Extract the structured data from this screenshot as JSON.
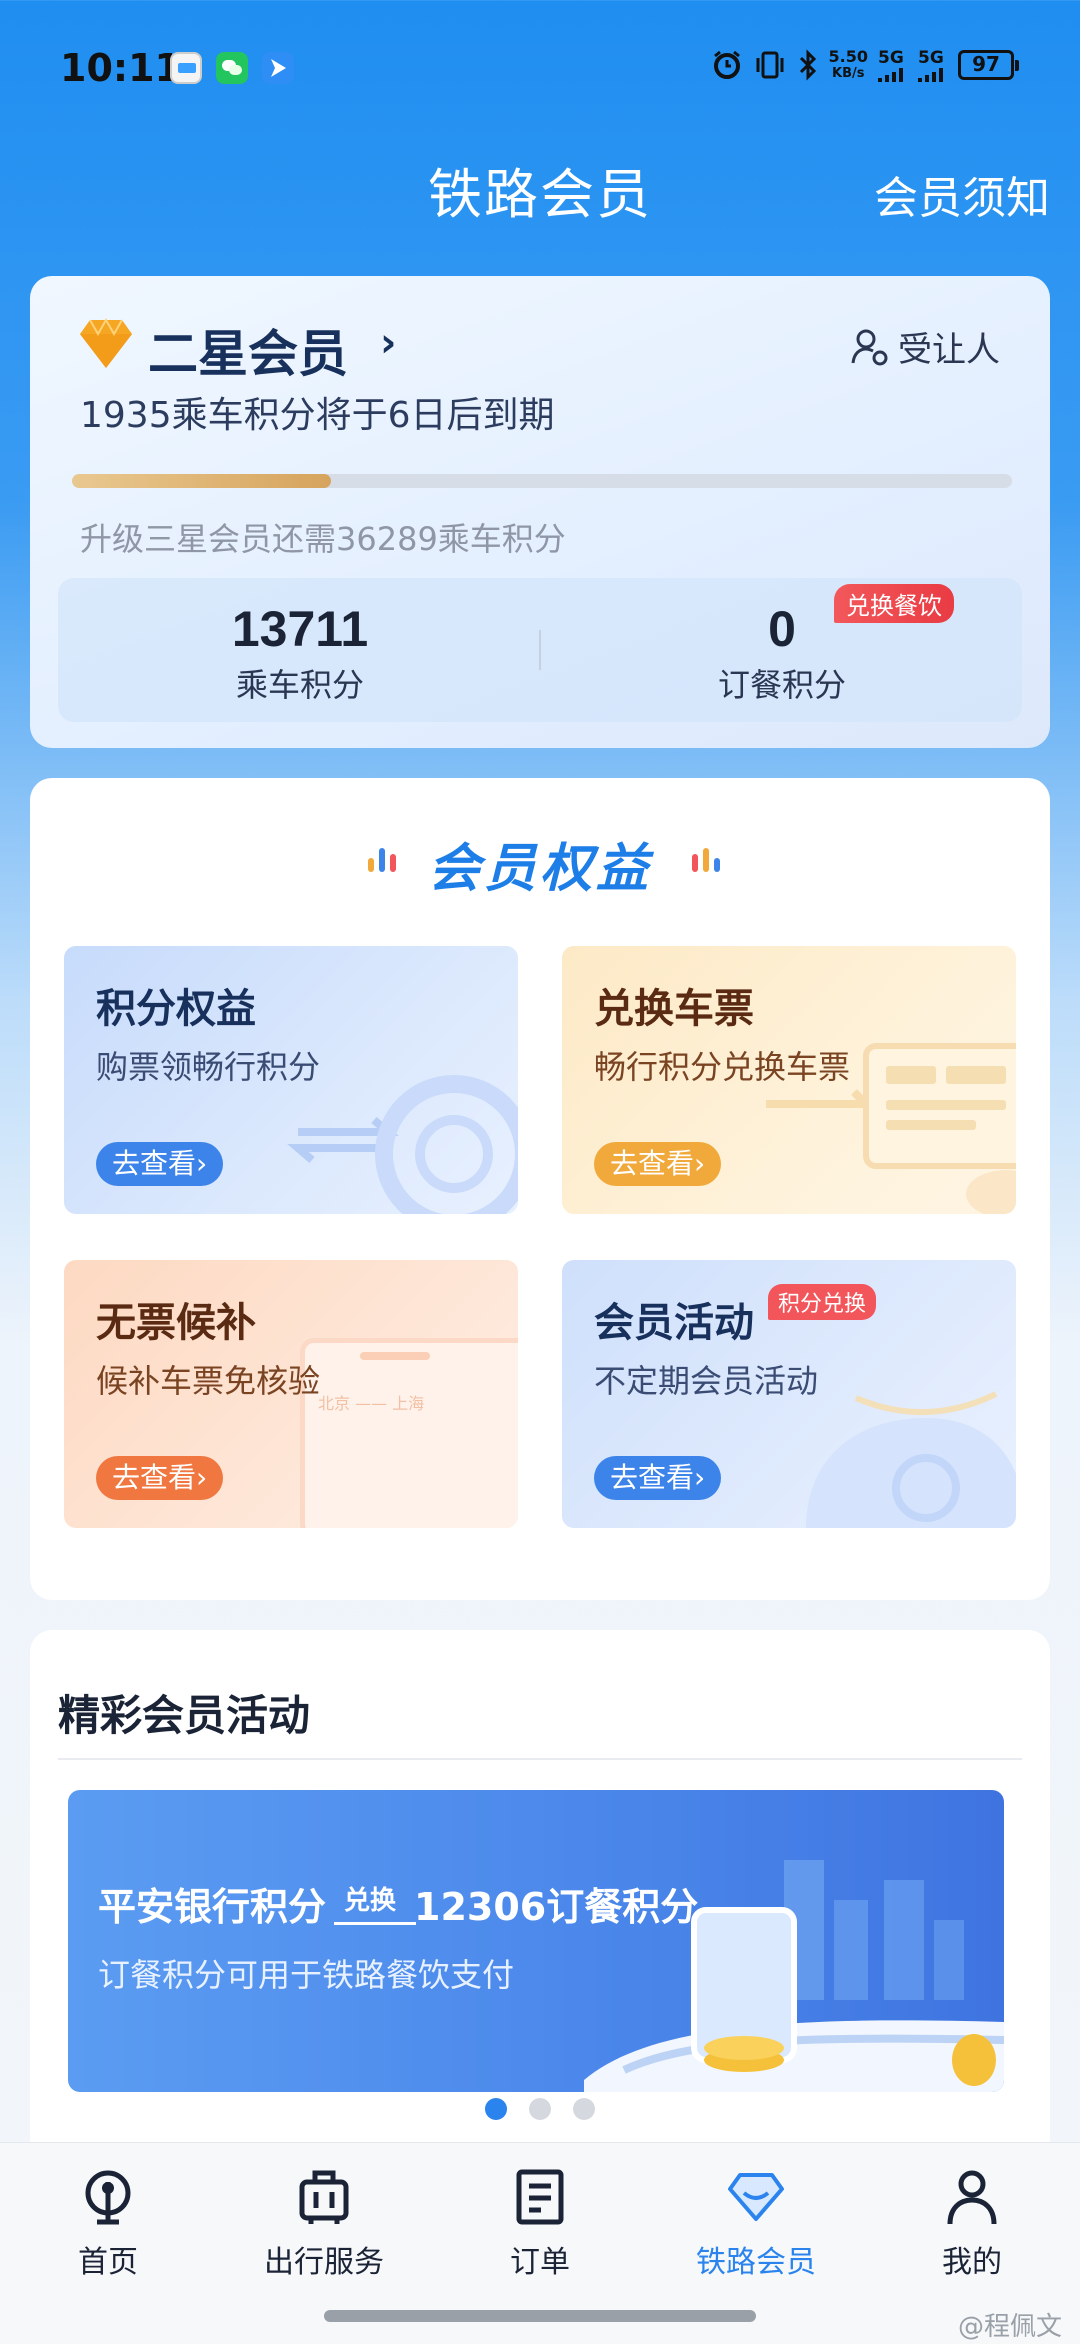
{
  "status_bar": {
    "time": "10:11",
    "net_speed_value": "5.50",
    "net_speed_unit": "KB/s",
    "sim1": "5G",
    "sim2": "5G",
    "battery": "97"
  },
  "header": {
    "title": "铁路会员",
    "notice_link": "会员须知"
  },
  "member": {
    "level": "二星会员",
    "arrow": "›",
    "transferee": "受让人",
    "expire_notice": "1935乘车积分将于6日后到期",
    "progress_fraction": 0.275,
    "upgrade_text": "升级三星会员还需36289乘车积分",
    "ride_points": {
      "value": "13711",
      "label": "乘车积分"
    },
    "meal_points": {
      "value": "0",
      "label": "订餐积分",
      "badge": "兑换餐饮"
    }
  },
  "benefits": {
    "title": "会员权益",
    "tiles": [
      {
        "title": "积分权益",
        "subtitle": "购票领畅行积分",
        "button": "去查看›"
      },
      {
        "title": "兑换车票",
        "subtitle": "畅行积分兑换车票",
        "button": "去查看›"
      },
      {
        "title": "无票候补",
        "subtitle": "候补车票免核验",
        "button": "去查看›"
      },
      {
        "title": "会员活动",
        "subtitle": "不定期会员活动",
        "button": "去查看›",
        "badge": "积分兑换"
      }
    ],
    "tile3_deco_text": "北京 —— 上海"
  },
  "activities": {
    "title": "精彩会员活动",
    "banner": {
      "left": "平安银行积分",
      "exchange": "兑换",
      "right": "12306订餐积分",
      "subtitle": "订餐积分可用于铁路餐饮支付"
    },
    "carousel_active_index": 0,
    "carousel_count": 3
  },
  "tabbar": {
    "items": [
      {
        "label": "首页",
        "icon": "railway-logo-icon"
      },
      {
        "label": "出行服务",
        "icon": "luggage-icon"
      },
      {
        "label": "订单",
        "icon": "document-icon"
      },
      {
        "label": "铁路会员",
        "icon": "diamond-icon",
        "active": true
      },
      {
        "label": "我的",
        "icon": "person-icon"
      }
    ]
  },
  "watermark": "@程佩文",
  "colors": {
    "primary": "#2b84ee",
    "header_bg": "#1f8ef1",
    "badge_red": "#f2555a"
  }
}
